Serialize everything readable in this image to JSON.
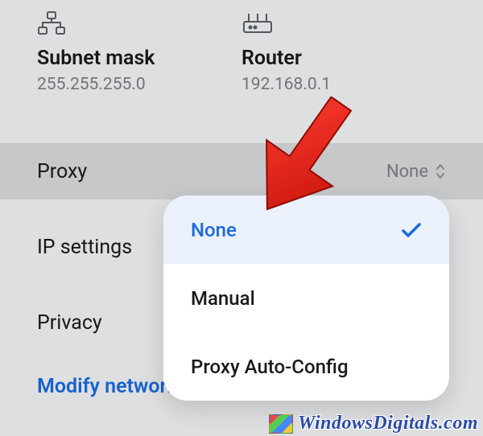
{
  "info": {
    "subnet": {
      "label": "Subnet mask",
      "value": "255.255.255.0",
      "icon": "network-topology-icon"
    },
    "router": {
      "label": "Router",
      "value": "192.168.0.1",
      "icon": "router-icon"
    }
  },
  "rows": {
    "proxy": {
      "label": "Proxy",
      "value": "None"
    },
    "ip": {
      "label": "IP settings"
    },
    "privacy": {
      "label": "Privacy"
    }
  },
  "modify_label": "Modify network",
  "proxy_options": {
    "none": "None",
    "manual": "Manual",
    "pac": "Proxy Auto-Config"
  },
  "watermark": "WindowsDigitals.com"
}
